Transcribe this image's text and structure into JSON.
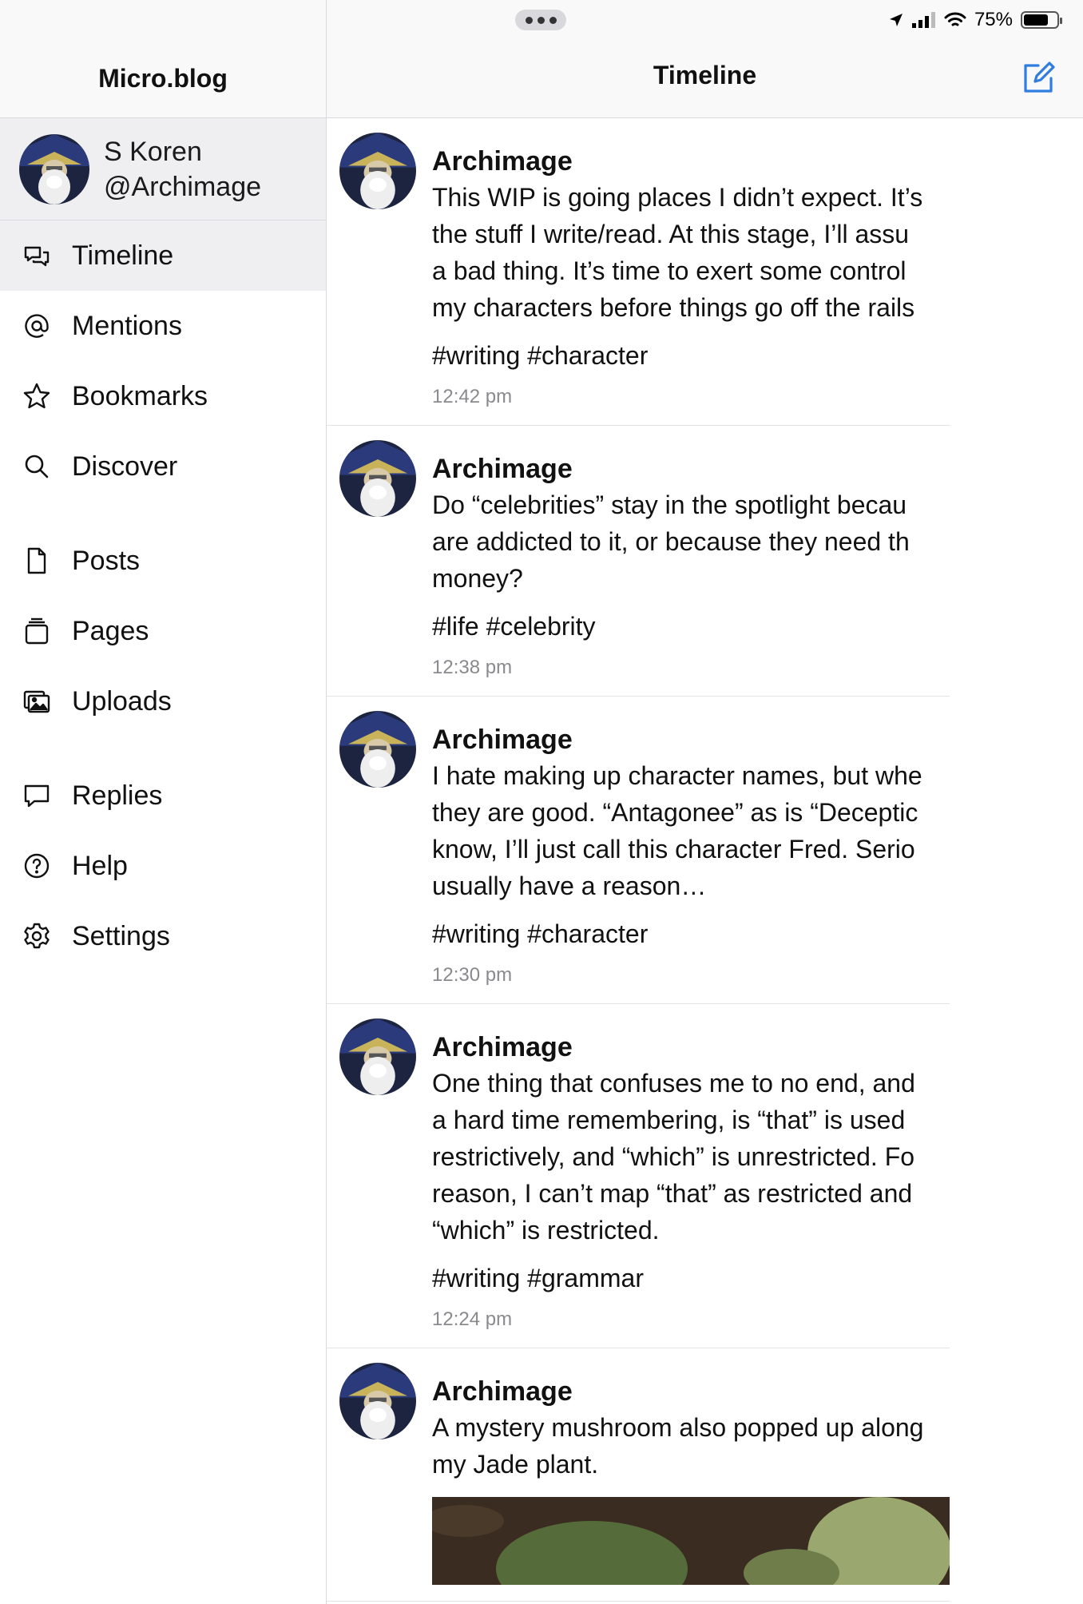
{
  "sidebar": {
    "title": "Micro.blog",
    "profile": {
      "name": "S Koren",
      "handle": "@Archimage"
    },
    "items": [
      {
        "label": "Timeline",
        "icon": "timeline-icon",
        "active": true
      },
      {
        "label": "Mentions",
        "icon": "at-icon"
      },
      {
        "label": "Bookmarks",
        "icon": "star-icon"
      },
      {
        "label": "Discover",
        "icon": "search-icon"
      },
      {
        "label": "Posts",
        "icon": "document-icon"
      },
      {
        "label": "Pages",
        "icon": "pages-icon"
      },
      {
        "label": "Uploads",
        "icon": "photos-icon"
      },
      {
        "label": "Replies",
        "icon": "speech-bubble-icon"
      },
      {
        "label": "Help",
        "icon": "question-circle-icon"
      },
      {
        "label": "Settings",
        "icon": "gear-icon"
      }
    ]
  },
  "header": {
    "title": "Timeline",
    "compose_icon": "compose-icon"
  },
  "status": {
    "battery": "75%",
    "battery_level": 0.75
  },
  "posts": [
    {
      "author": "Archimage",
      "lines": [
        "This WIP is going places I didn’t expect. It’s",
        "the stuff I write/read. At this stage, I’ll assu",
        "a bad thing. It’s time to exert some control",
        "my characters before things go off the rails"
      ],
      "tags": "#writing #character",
      "time": "12:42 pm"
    },
    {
      "author": "Archimage",
      "lines": [
        "Do “celebrities” stay in the spotlight becau",
        "are addicted to it, or because they need th",
        "money?"
      ],
      "tags": "#life #celebrity",
      "time": "12:38 pm"
    },
    {
      "author": "Archimage",
      "lines": [
        "I hate making up character names, but whe",
        "they are good. “Antagonee” as is “Deceptic",
        "know, I’ll just call this character Fred. Serio",
        "usually have a reason…"
      ],
      "tags": "#writing #character",
      "time": "12:30 pm"
    },
    {
      "author": "Archimage",
      "lines": [
        "One thing that confuses me to no end, and",
        "a hard time remembering, is “that” is used",
        "restrictively, and “which” is unrestricted. Fo",
        "reason, I can’t map “that” as restricted and",
        "“which” is restricted."
      ],
      "tags": "#writing #grammar",
      "time": "12:24 pm"
    },
    {
      "author": "Archimage",
      "lines": [
        "A mystery mushroom also popped up along",
        "my Jade plant."
      ],
      "has_image": true
    }
  ],
  "colors": {
    "accent": "#2f7de1",
    "sidebar_selected": "#efeff2",
    "timestamp": "#8a8a8e"
  }
}
